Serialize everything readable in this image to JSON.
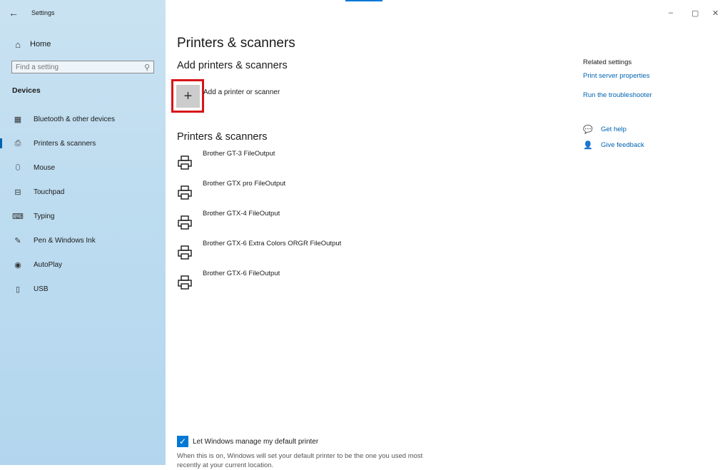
{
  "window": {
    "title": "Settings",
    "back": "←",
    "controls": {
      "minimize": "–",
      "maximize": "▢",
      "close": "✕"
    }
  },
  "sidebar": {
    "home": {
      "label": "Home",
      "icon": "home-icon",
      "glyph": "⌂"
    },
    "search": {
      "placeholder": "Find a setting",
      "icon": "search-icon",
      "glyph": "⚲"
    },
    "section": "Devices",
    "items": [
      {
        "label": "Bluetooth & other devices",
        "icon": "bluetooth-devices-icon",
        "glyph": "▦",
        "selected": false
      },
      {
        "label": "Printers & scanners",
        "icon": "printer-icon",
        "glyph": "⎙",
        "selected": true
      },
      {
        "label": "Mouse",
        "icon": "mouse-icon",
        "glyph": "⬯",
        "selected": false
      },
      {
        "label": "Touchpad",
        "icon": "touchpad-icon",
        "glyph": "⊟",
        "selected": false
      },
      {
        "label": "Typing",
        "icon": "keyboard-icon",
        "glyph": "⌨",
        "selected": false
      },
      {
        "label": "Pen & Windows Ink",
        "icon": "pen-icon",
        "glyph": "✎",
        "selected": false
      },
      {
        "label": "AutoPlay",
        "icon": "autoplay-icon",
        "glyph": "◉",
        "selected": false
      },
      {
        "label": "USB",
        "icon": "usb-icon",
        "glyph": "▯",
        "selected": false
      }
    ]
  },
  "main": {
    "title": "Printers & scanners",
    "add_section": {
      "heading": "Add printers & scanners",
      "button_glyph": "+",
      "button_label": "Add a printer or scanner"
    },
    "list": {
      "heading": "Printers & scanners",
      "printers": [
        "Brother GT-3 FileOutput",
        "Brother GTX pro FileOutput",
        "Brother GTX-4 FileOutput",
        "Brother GTX-6 Extra Colors ORGR FileOutput",
        "Brother GTX-6 FileOutput"
      ]
    },
    "default_printer": {
      "checked": true,
      "check_glyph": "✓",
      "label": "Let Windows manage my default printer",
      "description": "When this is on, Windows will set your default printer to be the one you used most recently at your current location."
    }
  },
  "related": {
    "heading": "Related settings",
    "links": [
      "Print server properties",
      "Run the troubleshooter"
    ],
    "help": [
      {
        "label": "Get help",
        "icon": "get-help-icon",
        "glyph": "💬"
      },
      {
        "label": "Give feedback",
        "icon": "feedback-icon",
        "glyph": "👤"
      }
    ]
  },
  "colors": {
    "accent": "#0078d4",
    "highlight_box": "#d7141a",
    "sidebar_bg": "#bddcf0",
    "link": "#0063b1"
  }
}
